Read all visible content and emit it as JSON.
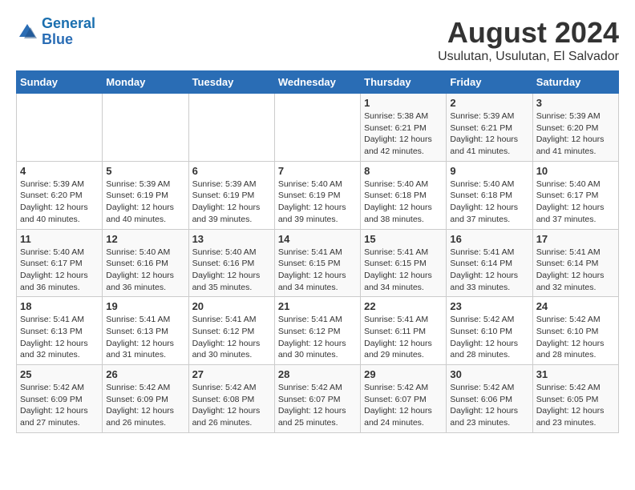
{
  "logo": {
    "text_general": "General",
    "text_blue": "Blue"
  },
  "title": "August 2024",
  "subtitle": "Usulutan, Usulutan, El Salvador",
  "days_of_week": [
    "Sunday",
    "Monday",
    "Tuesday",
    "Wednesday",
    "Thursday",
    "Friday",
    "Saturday"
  ],
  "weeks": [
    [
      {
        "day": "",
        "info": ""
      },
      {
        "day": "",
        "info": ""
      },
      {
        "day": "",
        "info": ""
      },
      {
        "day": "",
        "info": ""
      },
      {
        "day": "1",
        "info": "Sunrise: 5:38 AM\nSunset: 6:21 PM\nDaylight: 12 hours\nand 42 minutes."
      },
      {
        "day": "2",
        "info": "Sunrise: 5:39 AM\nSunset: 6:21 PM\nDaylight: 12 hours\nand 41 minutes."
      },
      {
        "day": "3",
        "info": "Sunrise: 5:39 AM\nSunset: 6:20 PM\nDaylight: 12 hours\nand 41 minutes."
      }
    ],
    [
      {
        "day": "4",
        "info": "Sunrise: 5:39 AM\nSunset: 6:20 PM\nDaylight: 12 hours\nand 40 minutes."
      },
      {
        "day": "5",
        "info": "Sunrise: 5:39 AM\nSunset: 6:19 PM\nDaylight: 12 hours\nand 40 minutes."
      },
      {
        "day": "6",
        "info": "Sunrise: 5:39 AM\nSunset: 6:19 PM\nDaylight: 12 hours\nand 39 minutes."
      },
      {
        "day": "7",
        "info": "Sunrise: 5:40 AM\nSunset: 6:19 PM\nDaylight: 12 hours\nand 39 minutes."
      },
      {
        "day": "8",
        "info": "Sunrise: 5:40 AM\nSunset: 6:18 PM\nDaylight: 12 hours\nand 38 minutes."
      },
      {
        "day": "9",
        "info": "Sunrise: 5:40 AM\nSunset: 6:18 PM\nDaylight: 12 hours\nand 37 minutes."
      },
      {
        "day": "10",
        "info": "Sunrise: 5:40 AM\nSunset: 6:17 PM\nDaylight: 12 hours\nand 37 minutes."
      }
    ],
    [
      {
        "day": "11",
        "info": "Sunrise: 5:40 AM\nSunset: 6:17 PM\nDaylight: 12 hours\nand 36 minutes."
      },
      {
        "day": "12",
        "info": "Sunrise: 5:40 AM\nSunset: 6:16 PM\nDaylight: 12 hours\nand 36 minutes."
      },
      {
        "day": "13",
        "info": "Sunrise: 5:40 AM\nSunset: 6:16 PM\nDaylight: 12 hours\nand 35 minutes."
      },
      {
        "day": "14",
        "info": "Sunrise: 5:41 AM\nSunset: 6:15 PM\nDaylight: 12 hours\nand 34 minutes."
      },
      {
        "day": "15",
        "info": "Sunrise: 5:41 AM\nSunset: 6:15 PM\nDaylight: 12 hours\nand 34 minutes."
      },
      {
        "day": "16",
        "info": "Sunrise: 5:41 AM\nSunset: 6:14 PM\nDaylight: 12 hours\nand 33 minutes."
      },
      {
        "day": "17",
        "info": "Sunrise: 5:41 AM\nSunset: 6:14 PM\nDaylight: 12 hours\nand 32 minutes."
      }
    ],
    [
      {
        "day": "18",
        "info": "Sunrise: 5:41 AM\nSunset: 6:13 PM\nDaylight: 12 hours\nand 32 minutes."
      },
      {
        "day": "19",
        "info": "Sunrise: 5:41 AM\nSunset: 6:13 PM\nDaylight: 12 hours\nand 31 minutes."
      },
      {
        "day": "20",
        "info": "Sunrise: 5:41 AM\nSunset: 6:12 PM\nDaylight: 12 hours\nand 30 minutes."
      },
      {
        "day": "21",
        "info": "Sunrise: 5:41 AM\nSunset: 6:12 PM\nDaylight: 12 hours\nand 30 minutes."
      },
      {
        "day": "22",
        "info": "Sunrise: 5:41 AM\nSunset: 6:11 PM\nDaylight: 12 hours\nand 29 minutes."
      },
      {
        "day": "23",
        "info": "Sunrise: 5:42 AM\nSunset: 6:10 PM\nDaylight: 12 hours\nand 28 minutes."
      },
      {
        "day": "24",
        "info": "Sunrise: 5:42 AM\nSunset: 6:10 PM\nDaylight: 12 hours\nand 28 minutes."
      }
    ],
    [
      {
        "day": "25",
        "info": "Sunrise: 5:42 AM\nSunset: 6:09 PM\nDaylight: 12 hours\nand 27 minutes."
      },
      {
        "day": "26",
        "info": "Sunrise: 5:42 AM\nSunset: 6:09 PM\nDaylight: 12 hours\nand 26 minutes."
      },
      {
        "day": "27",
        "info": "Sunrise: 5:42 AM\nSunset: 6:08 PM\nDaylight: 12 hours\nand 26 minutes."
      },
      {
        "day": "28",
        "info": "Sunrise: 5:42 AM\nSunset: 6:07 PM\nDaylight: 12 hours\nand 25 minutes."
      },
      {
        "day": "29",
        "info": "Sunrise: 5:42 AM\nSunset: 6:07 PM\nDaylight: 12 hours\nand 24 minutes."
      },
      {
        "day": "30",
        "info": "Sunrise: 5:42 AM\nSunset: 6:06 PM\nDaylight: 12 hours\nand 23 minutes."
      },
      {
        "day": "31",
        "info": "Sunrise: 5:42 AM\nSunset: 6:05 PM\nDaylight: 12 hours\nand 23 minutes."
      }
    ]
  ]
}
